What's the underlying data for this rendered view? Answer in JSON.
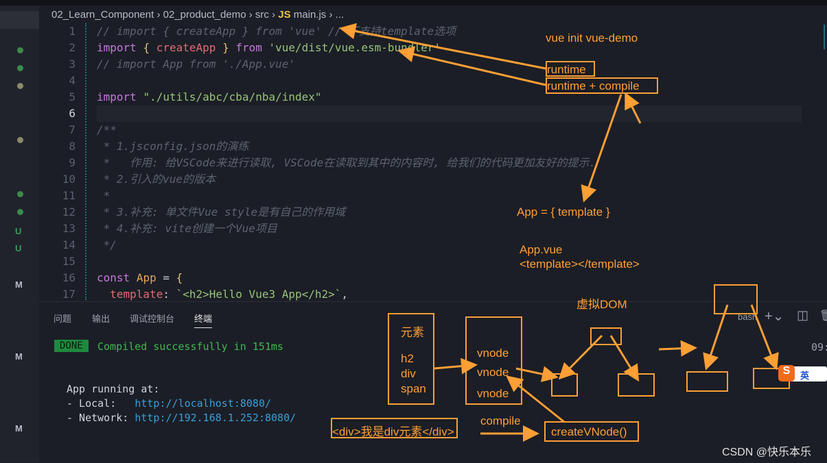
{
  "breadcrumb": [
    "02_Learn_Component",
    "02_product_demo",
    "src",
    "main.js",
    "..."
  ],
  "breadcrumb_file_icon": "JS",
  "editor": {
    "current_line": 6,
    "lines": [
      {
        "n": "1",
        "html": "cm",
        "text": "// import { createApp } from 'vue' // 不支持template选项"
      },
      {
        "n": "2",
        "text": "import { createApp } from 'vue/dist/vue.esm-bundler'"
      },
      {
        "n": "3",
        "text": "// import App from './App.vue'"
      },
      {
        "n": "4",
        "text": ""
      },
      {
        "n": "5",
        "text": "import \"./utils/abc/cba/nba/index\""
      },
      {
        "n": "6",
        "text": ""
      },
      {
        "n": "7",
        "text": "/**"
      },
      {
        "n": "8",
        "text": " * 1.jsconfig.json的演练"
      },
      {
        "n": "9",
        "text": " *   作用: 给VSCode来进行读取, VSCode在读取到其中的内容时, 给我们的代码更加友好的提示."
      },
      {
        "n": "10",
        "text": " * 2.引入的vue的版本"
      },
      {
        "n": "11",
        "text": " *"
      },
      {
        "n": "12",
        "text": " * 3.补充: 单文件Vue style是有自己的作用域"
      },
      {
        "n": "13",
        "text": " * 4.补充: vite创建一个Vue项目"
      },
      {
        "n": "14",
        "text": " */"
      },
      {
        "n": "15",
        "text": ""
      },
      {
        "n": "16",
        "text": "const App = {"
      },
      {
        "n": "17",
        "text": "  template: `<h2>Hello Vue3 App</h2>`,"
      }
    ]
  },
  "panel": {
    "tabs": [
      "问题",
      "输出",
      "调试控制台",
      "终端"
    ],
    "active_tab": "终端",
    "shell": "bash",
    "time": "09:",
    "done_badge": "DONE",
    "compiled": "Compiled successfully in 151ms",
    "running": "App running at:",
    "local_label": "- Local:   ",
    "local_url": "http://localhost:8080/",
    "network_label": "- Network: ",
    "network_url": "http://192.168.1.252:8080/"
  },
  "annotations": {
    "cmd": "vue init vue-demo",
    "runtime": "runtime",
    "runtime_compile": "runtime + compile",
    "app_template": "App = { template }",
    "app_vue": "App.vue",
    "template_tag": "<template></template>",
    "vdom": "虚拟DOM",
    "element_box": [
      "元素",
      "h2",
      "div",
      "span"
    ],
    "vnode_box": [
      "vnode",
      "vnode",
      "vnode"
    ],
    "div_elem": "<div>我是div元素</div>",
    "compile": "compile",
    "create_vnode": "createVNode()"
  },
  "ime": "英",
  "watermark": "CSDN @快乐本乐",
  "colors": {
    "annotation": "#ff9f35",
    "done": "#1d8a3e",
    "link": "#3a9fd8"
  }
}
